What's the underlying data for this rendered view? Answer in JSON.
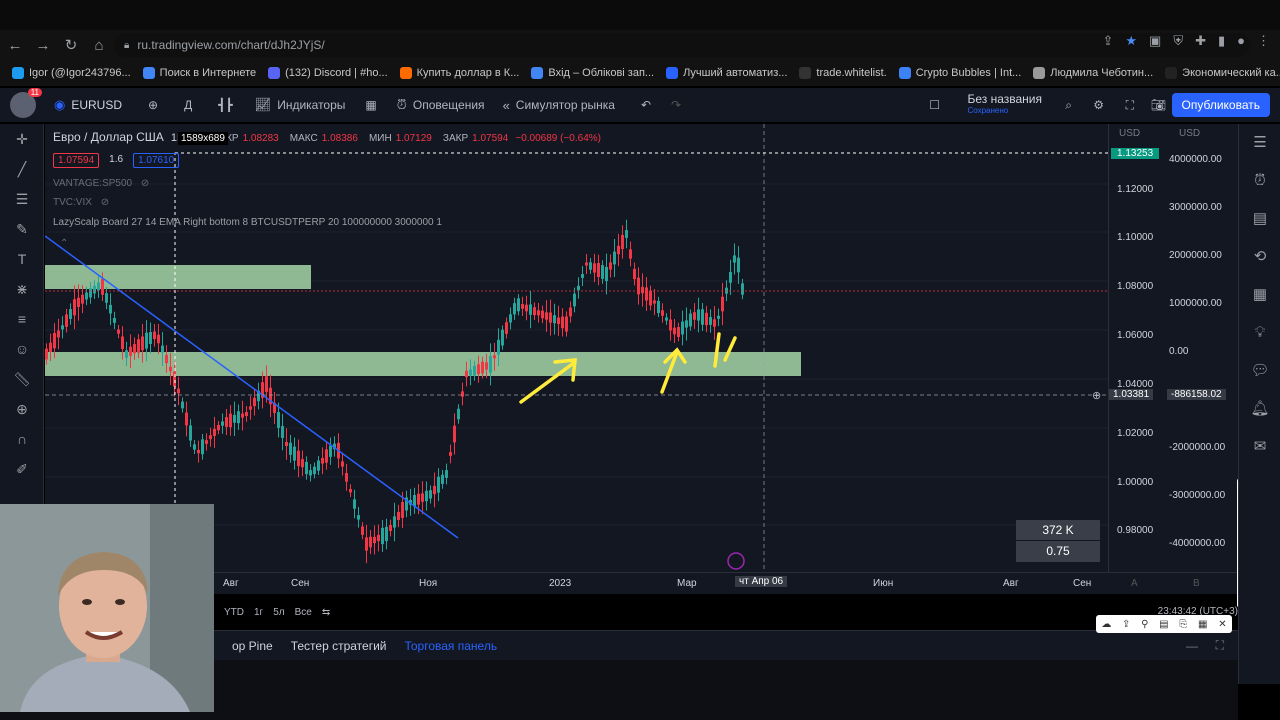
{
  "browser": {
    "url": "ru.tradingview.com/chart/dJh2JYjS/",
    "bookmarks": [
      {
        "label": "Igor (@Igor243796...",
        "color": "#1d9bf0"
      },
      {
        "label": "Поиск в Интернете",
        "color": "#4285f4"
      },
      {
        "label": "(132) Discord | #ho...",
        "color": "#5865f2"
      },
      {
        "label": "Купить доллар в К...",
        "color": "#ff6b00"
      },
      {
        "label": "Вхід – Облікові зап...",
        "color": "#4285f4"
      },
      {
        "label": "Лучший автоматиз...",
        "color": "#2962ff"
      },
      {
        "label": "trade.whitelist.",
        "color": "#333333"
      },
      {
        "label": "Crypto Bubbles | Int...",
        "color": "#3b82f6"
      },
      {
        "label": "Людмила Чеботин...",
        "color": "#999999"
      },
      {
        "label": "Экономический ка...",
        "color": "#222222"
      }
    ]
  },
  "toolbar": {
    "avatar_badge": "11",
    "symbol": "EURUSD",
    "interval": "Д",
    "indicators_label": "Индикаторы",
    "alerts_label": "Оповещения",
    "replay_label": "Симулятор рынка",
    "layout_name": "Без названия",
    "layout_saved": "Сохранено",
    "publish_label": "Опубликовать"
  },
  "legend": {
    "symbol_name": "Евро / Доллар США",
    "interval_tag": "1D",
    "exchange": "M",
    "open_key": "ОТКР",
    "open_val": "1.08283",
    "high_key": "МАКС",
    "high_val": "1.08386",
    "low_key": "МИН",
    "low_val": "1.07129",
    "close_key": "ЗАКР",
    "close_val": "1.07594",
    "change": "−0.00689 (−0.64%)",
    "bid": "1.07594",
    "spread": "1.6",
    "ask": "1.07610",
    "ind1": "VANTAGE:SP500",
    "ind2": "TVC:VIX",
    "lazyscalp": "LazyScalp Board 27 14 EMA Right bottom 8 BTCUSDTPERP 20 100000000 3000000 1",
    "size_badge": "1589x689"
  },
  "price_axis": {
    "currency_left": "USD",
    "currency_right": "USD",
    "current_badge": "1.13253",
    "left_ticks": [
      "1.12000",
      "1.10000",
      "1.08000",
      "1.06000",
      "1.04000",
      "1.02000",
      "1.00000",
      "0.98000"
    ],
    "right_ticks": [
      "4000000.00",
      "3000000.00",
      "2000000.00",
      "1000000.00",
      "0.00",
      "-2000000.00",
      "-3000000.00",
      "-4000000.00"
    ],
    "crosshair_price": "1.03381",
    "crosshair_value": "-886158.02"
  },
  "time_axis": {
    "labels": [
      "Авг",
      "Сен",
      "Ноя",
      "2023",
      "Мар",
      "Июн",
      "Авг",
      "Сен"
    ],
    "crosshair_label": "чт Апр 06",
    "right_a": "A",
    "right_b": "B"
  },
  "stats_box": {
    "top": "372 K",
    "bottom": "0.75"
  },
  "range_bar": {
    "items": [
      "YTD",
      "1г",
      "5л",
      "Все"
    ],
    "clock": "23:43:42 (UTC+3)"
  },
  "bottom_tabs": {
    "pine": "op Pine",
    "tester": "Тестер стратегий",
    "panel": "Торговая панель"
  },
  "colors": {
    "bg": "#131722",
    "up": "#26a69a",
    "down": "#f23645",
    "zone": "#a5d6a7",
    "trendline": "#2962ff",
    "annotation": "#ffeb3b"
  }
}
